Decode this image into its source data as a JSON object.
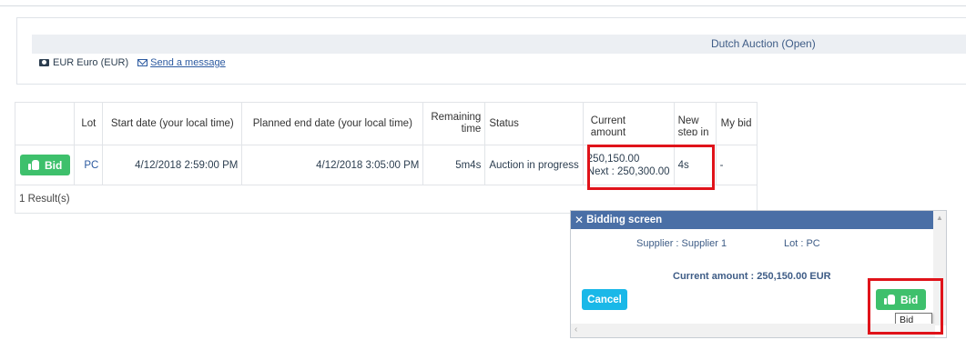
{
  "auction": {
    "title": "Dutch Auction (Open)",
    "currency": "EUR Euro (EUR)",
    "send_message": "Send a message"
  },
  "table": {
    "headers": {
      "lot": "Lot",
      "start": "Start date (your local time)",
      "end": "Planned end date (your local time)",
      "remaining_1": "Remaining",
      "remaining_2": "time",
      "status": "Status",
      "current_1": "Current",
      "current_2": "amount",
      "step_1": "New",
      "step_2": "step in",
      "mybid": "My bid"
    },
    "row": {
      "bid_label": "Bid",
      "lot": "PC",
      "start": "4/12/2018 2:59:00 PM",
      "end": "4/12/2018 3:05:00 PM",
      "remaining": "5m4s",
      "status": "Auction in progress",
      "current": "250,150.00",
      "next": "Next : 250,300.00",
      "step": "4s",
      "mybid": "-"
    },
    "results": "1 Result(s)"
  },
  "modal": {
    "title": "Bidding screen",
    "supplier": "Supplier : Supplier 1",
    "lot": "Lot : PC",
    "current_amount": "Current amount : 250,150.00 EUR",
    "cancel": "Cancel",
    "bid": "Bid",
    "tooltip": "Bid"
  },
  "colors": {
    "bid_green": "#3ec06c",
    "cancel_blue": "#1ab8e8",
    "modal_header": "#4a6fa6",
    "highlight_red": "#e0131a"
  }
}
